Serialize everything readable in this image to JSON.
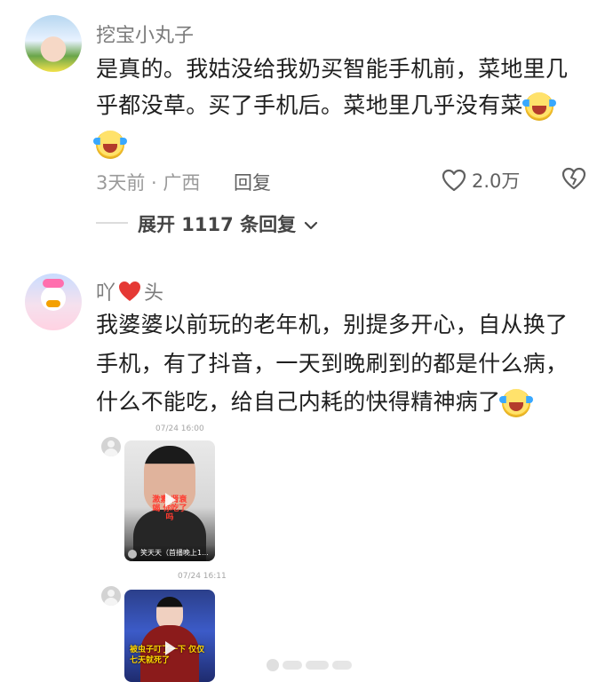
{
  "comments": [
    {
      "username": "挖宝小丸子",
      "lines": [
        "是真的。我姑没给我奶买智能手机前，菜地里几",
        "乎都没草。买了手机后。菜地里几乎没有菜"
      ],
      "emoji": "laughing-tears-emoji",
      "meta": "3天前 · 广西",
      "reply_label": "回复",
      "likes": "2.0万",
      "expand_label": "展开 1117 条回复"
    },
    {
      "username": "吖",
      "username_suffix": "头",
      "lines": [
        "我婆婆以前玩的老年机，别提多开心，自从换了",
        "手机，有了抖音，一天到晚刷到的都是什么病，",
        "什么不能吃，给自己内耗的快得精神病了"
      ],
      "emoji": "laughing-tears-emoji"
    }
  ],
  "media": [
    {
      "timestamp": "07/24 16:00",
      "overlay_text": "激素 肾衰竭 你吃了吗",
      "caption": "笑天天（首播晚上1..."
    },
    {
      "timestamp": "07/24 16:11",
      "overlay_text": "被虫子叮了一下 仅仅七天就死了"
    }
  ],
  "colors": {
    "text": "#1f1f1f",
    "username": "#7b7b7b",
    "meta": "#9a9a9a",
    "heart_red": "#e53935"
  }
}
